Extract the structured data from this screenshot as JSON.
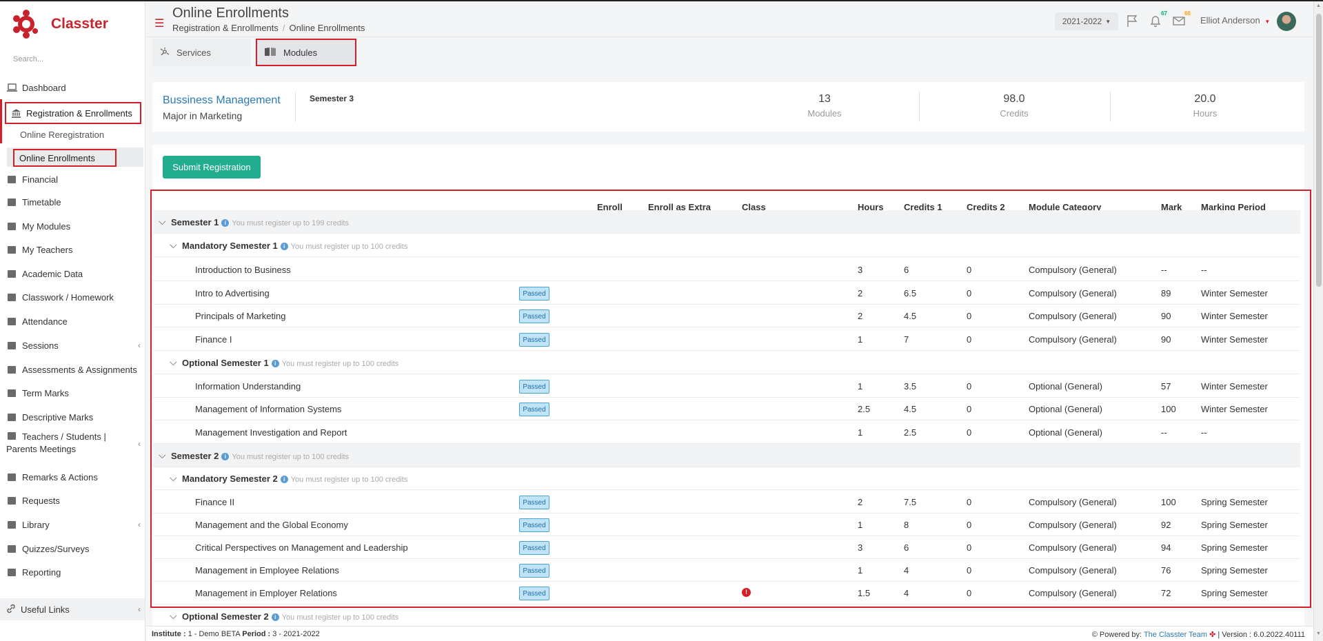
{
  "app": {
    "name": "Classter",
    "brand_color": "#c8232c",
    "accent_color": "#d51e27"
  },
  "sidebar": {
    "search_placeholder": "Search...",
    "items": [
      {
        "label": "Dashboard",
        "icon": "laptop-icon"
      },
      {
        "label": "Registration & Enrollments",
        "icon": "bank-icon"
      },
      {
        "label": "Financial",
        "icon": "coins-icon"
      },
      {
        "label": "Timetable",
        "icon": "calendar-icon"
      },
      {
        "label": "My Modules",
        "icon": "book-icon"
      },
      {
        "label": "My Teachers",
        "icon": "users-icon"
      },
      {
        "label": "Academic Data",
        "icon": "certificate-icon"
      },
      {
        "label": "Classwork / Homework",
        "icon": "list-icon"
      },
      {
        "label": "Attendance",
        "icon": "user-check-icon"
      },
      {
        "label": "Sessions",
        "icon": "sessions-icon"
      },
      {
        "label": "Assessments & Assignments",
        "icon": "edit-icon"
      },
      {
        "label": "Term Marks",
        "icon": "book-closed-icon"
      },
      {
        "label": "Descriptive Marks",
        "icon": "checkbox-icon"
      },
      {
        "label": "Teachers / Students |",
        "label2": "Parents Meetings",
        "icon": "meeting-icon"
      },
      {
        "label": "Remarks & Actions",
        "icon": "shuffle-icon"
      },
      {
        "label": "Requests",
        "icon": "folder-icon"
      },
      {
        "label": "Library",
        "icon": "library-icon"
      },
      {
        "label": "Quizzes/Surveys",
        "icon": "clipboard-icon"
      },
      {
        "label": "Reporting",
        "icon": "printer-icon"
      }
    ],
    "sub_items": [
      "Online Reregistration",
      "Online Enrollments"
    ],
    "useful_links": "Useful Links"
  },
  "header": {
    "title": "Online Enrollments",
    "breadcrumb": [
      "Registration & Enrollments",
      "Online Enrollments"
    ],
    "year": "2021-2022",
    "notifications_count": "67",
    "messages_count": "68",
    "user_name": "Elliot Anderson"
  },
  "tabs": {
    "services": "Services",
    "modules": "Modules"
  },
  "summary": {
    "program": "Bussiness Management",
    "major": "Major in Marketing",
    "semester": "Semester 3",
    "modules_value": "13",
    "modules_label": "Modules",
    "credits_value": "98.0",
    "credits_label": "Credits",
    "hours_value": "20.0",
    "hours_label": "Hours"
  },
  "actions": {
    "submit": "Submit Registration"
  },
  "table": {
    "headers": {
      "enroll": "Enroll",
      "enroll_extra": "Enroll as Extra",
      "class": "Class",
      "hours": "Hours",
      "credits1": "Credits 1",
      "credits2": "Credits 2",
      "category": "Module Category",
      "mark": "Mark",
      "period": "Marking Period"
    },
    "passed_label": "Passed",
    "rows": [
      {
        "type": "group",
        "level": 1,
        "name": "Semester 1",
        "hint": "You must register up to 199 credits"
      },
      {
        "type": "group",
        "level": 2,
        "name": "Mandatory Semester 1",
        "hint": "You must register up to 100 credits"
      },
      {
        "type": "module",
        "name": "Introduction to Business",
        "passed": false,
        "hours": "3",
        "c1": "6",
        "c2": "0",
        "category": "Compulsory (General)",
        "mark": "--",
        "period": "--"
      },
      {
        "type": "module",
        "name": "Intro to Advertising",
        "passed": true,
        "hours": "2",
        "c1": "6.5",
        "c2": "0",
        "category": "Compulsory (General)",
        "mark": "89",
        "period": "Winter Semester"
      },
      {
        "type": "module",
        "name": "Principals of Marketing",
        "passed": true,
        "hours": "2",
        "c1": "4.5",
        "c2": "0",
        "category": "Compulsory (General)",
        "mark": "90",
        "period": "Winter Semester"
      },
      {
        "type": "module",
        "name": "Finance I",
        "passed": true,
        "hours": "1",
        "c1": "7",
        "c2": "0",
        "category": "Compulsory (General)",
        "mark": "90",
        "period": "Winter Semester"
      },
      {
        "type": "group",
        "level": 2,
        "name": "Optional Semester 1",
        "hint": "You must register up to 100 credits"
      },
      {
        "type": "module",
        "name": "Information Understanding",
        "passed": true,
        "hours": "1",
        "c1": "3.5",
        "c2": "0",
        "category": "Optional (General)",
        "mark": "57",
        "period": "Winter Semester"
      },
      {
        "type": "module",
        "name": "Management of Information Systems",
        "passed": true,
        "hours": "2.5",
        "c1": "4.5",
        "c2": "0",
        "category": "Optional (General)",
        "mark": "100",
        "period": "Winter Semester"
      },
      {
        "type": "module",
        "name": "Management Investigation and Report",
        "passed": false,
        "hours": "1",
        "c1": "2.5",
        "c2": "0",
        "category": "Optional (General)",
        "mark": "--",
        "period": "--"
      },
      {
        "type": "group",
        "level": 1,
        "name": "Semester 2",
        "hint": "You must register up to 100 credits"
      },
      {
        "type": "group",
        "level": 2,
        "name": "Mandatory Semester 2",
        "hint": "You must register up to 100 credits"
      },
      {
        "type": "module",
        "name": "Finance II",
        "passed": true,
        "hours": "2",
        "c1": "7.5",
        "c2": "0",
        "category": "Compulsory (General)",
        "mark": "100",
        "period": "Spring Semester"
      },
      {
        "type": "module",
        "name": "Management and the Global Economy",
        "passed": true,
        "hours": "1",
        "c1": "8",
        "c2": "0",
        "category": "Compulsory (General)",
        "mark": "92",
        "period": "Spring Semester"
      },
      {
        "type": "module",
        "name": "Critical Perspectives on Management and Leadership",
        "passed": true,
        "hours": "3",
        "c1": "6",
        "c2": "0",
        "category": "Compulsory (General)",
        "mark": "94",
        "period": "Spring Semester"
      },
      {
        "type": "module",
        "name": "Management in Employee Relations",
        "passed": true,
        "hours": "1",
        "c1": "4",
        "c2": "0",
        "category": "Compulsory (General)",
        "mark": "76",
        "period": "Spring Semester"
      },
      {
        "type": "module",
        "name": "Management in Employer Relations",
        "passed": true,
        "warning": true,
        "hours": "1.5",
        "c1": "4",
        "c2": "0",
        "category": "Compulsory (General)",
        "mark": "72",
        "period": "Spring Semester"
      },
      {
        "type": "group",
        "level": 2,
        "name": "Optional Semester 2",
        "hint": "You must register up to 100 credits"
      }
    ]
  },
  "footer": {
    "institute_label": "Institute :",
    "institute_value": "1 - Demo BETA",
    "period_label": "Period :",
    "period_value": "3 - 2021-2022",
    "powered_by": "Powered by:",
    "powered_link": "The Classter Team",
    "version": "| Version : 6.0.2022.40111"
  }
}
